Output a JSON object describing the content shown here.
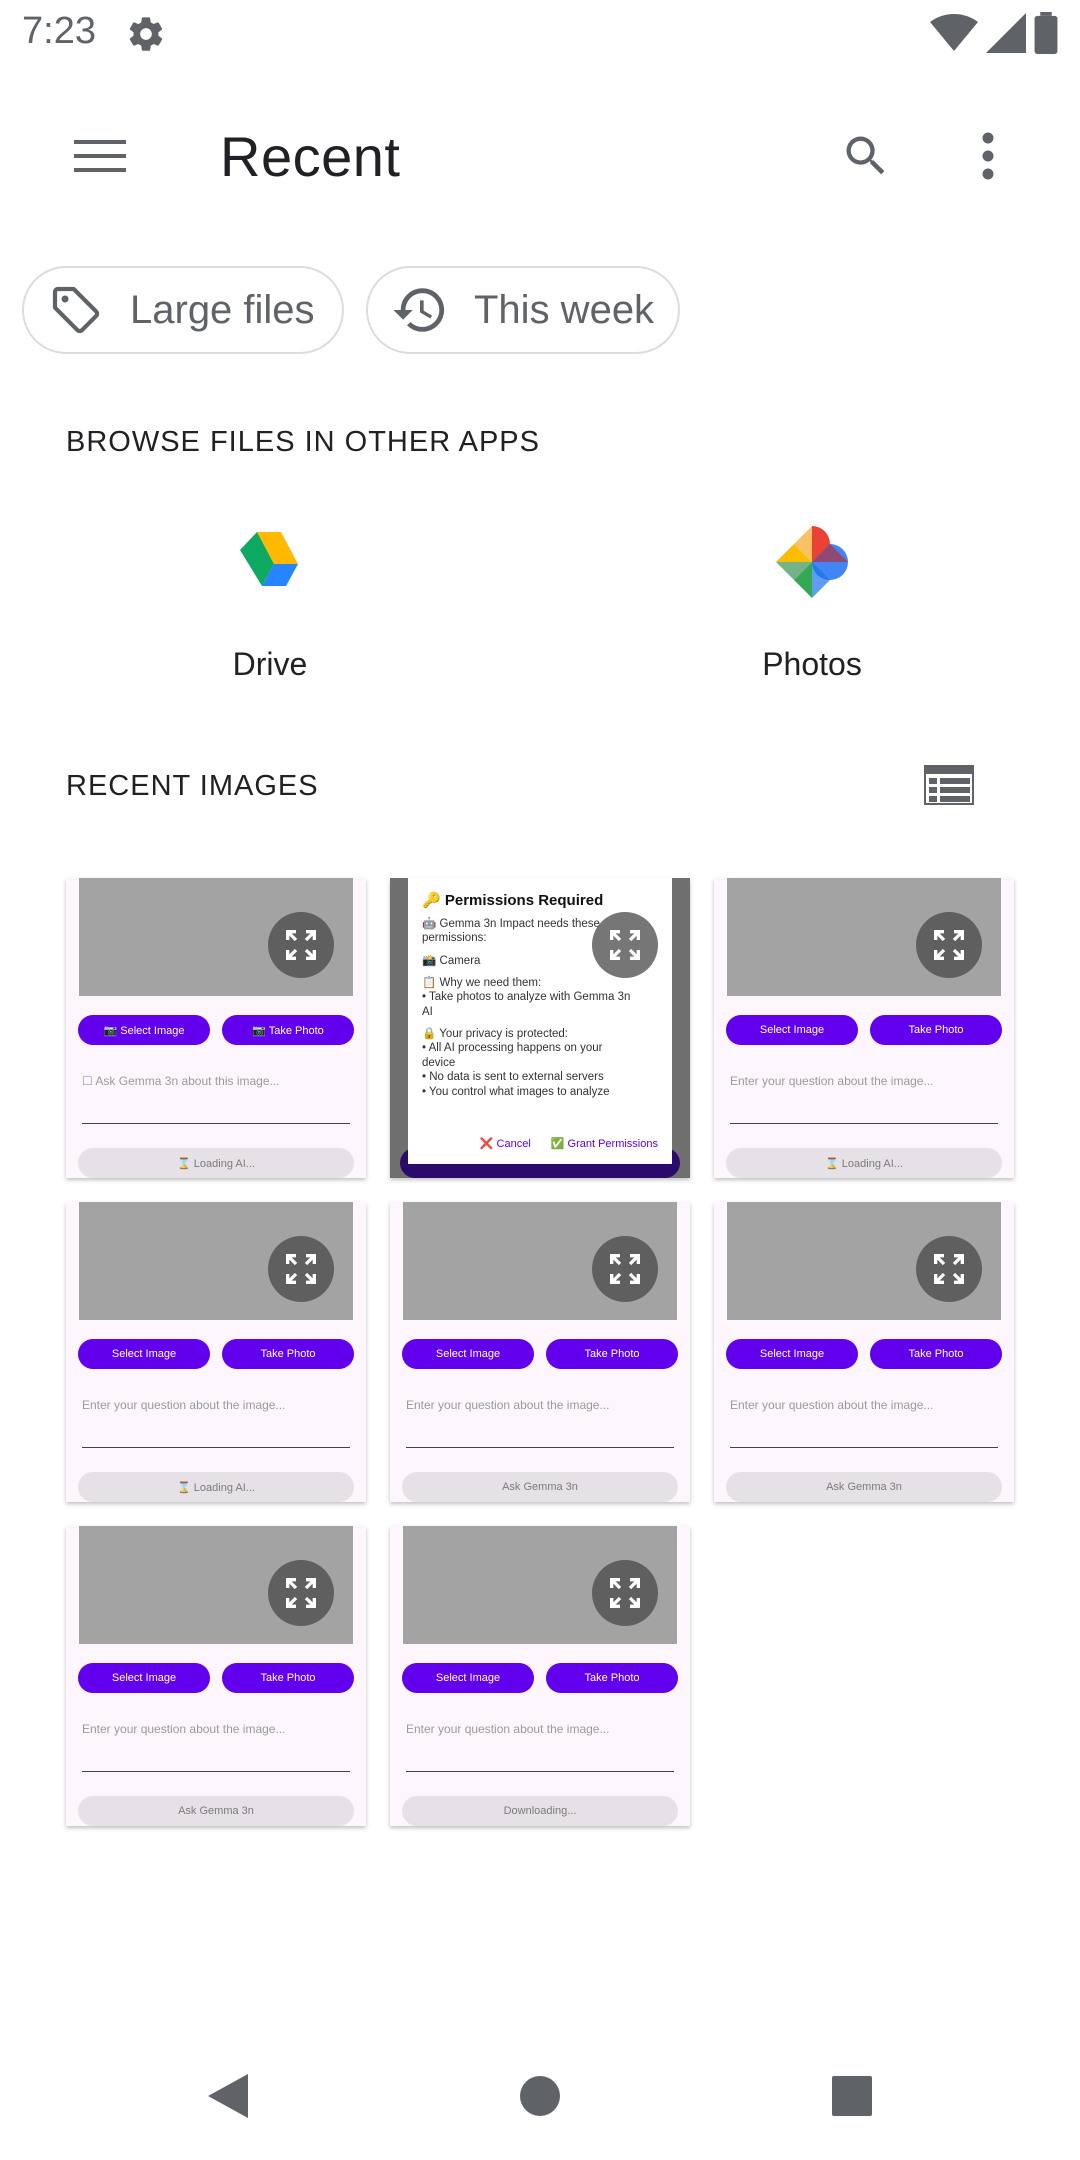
{
  "status_bar": {
    "time": "7:23",
    "icons": [
      "gear-icon",
      "wifi-icon",
      "signal-icon",
      "battery-icon"
    ]
  },
  "app_bar": {
    "title": "Recent",
    "menu_icon": "menu-icon",
    "search_icon": "search-icon",
    "more_icon": "more-vert-icon"
  },
  "chips": [
    {
      "label": "Large files",
      "icon": "tag-icon"
    },
    {
      "label": "This week",
      "icon": "history-icon"
    }
  ],
  "browse": {
    "title": "BROWSE FILES IN OTHER APPS",
    "apps": [
      {
        "label": "Drive",
        "icon": "drive-icon"
      },
      {
        "label": "Photos",
        "icon": "photos-icon"
      }
    ]
  },
  "recent_images": {
    "title": "RECENT IMAGES",
    "view_toggle_icon": "list-view-icon",
    "thumbnails": [
      {
        "select": "📷 Select Image",
        "take": "📷 Take Photo",
        "question": "☐  Ask Gemma 3n about this image...",
        "status": "⌛ Loading AI..."
      },
      {
        "dialog": true
      },
      {
        "select": "Select Image",
        "take": "Take Photo",
        "question": "Enter your question about the image...",
        "status": "⌛ Loading AI..."
      },
      {
        "select": "Select Image",
        "take": "Take Photo",
        "question": "Enter your question about the image...",
        "status": "⌛ Loading AI..."
      },
      {
        "select": "Select Image",
        "take": "Take Photo",
        "question": "Enter your question about the image...",
        "status": "Ask Gemma 3n"
      },
      {
        "select": "Select Image",
        "take": "Take Photo",
        "question": "Enter your question about the image...",
        "status": "Ask Gemma 3n"
      },
      {
        "select": "Select Image",
        "take": "Take Photo",
        "question": "Enter your question about the image...",
        "status": "Ask Gemma 3n"
      },
      {
        "select": "Select Image",
        "take": "Take Photo",
        "question": "Enter your question about the image...",
        "status": "Downloading..."
      }
    ],
    "dialog": {
      "title": "🔑 Permissions Required",
      "lines": [
        "🤖 Gemma 3n Impact needs these",
        "permissions:",
        "",
        "📸 Camera",
        "",
        "📋 Why we need them:",
        "• Take photos to analyze with Gemma 3n",
        "AI",
        "",
        "🔒 Your privacy is protected:",
        "• All AI processing happens on your",
        "device",
        "• No data is sent to external servers",
        "• You control what images to analyze"
      ],
      "cancel": "❌ Cancel",
      "grant": "✅ Grant Permissions"
    }
  },
  "nav_bar": {
    "back": "back-icon",
    "home": "home-icon",
    "recents": "recents-icon"
  }
}
